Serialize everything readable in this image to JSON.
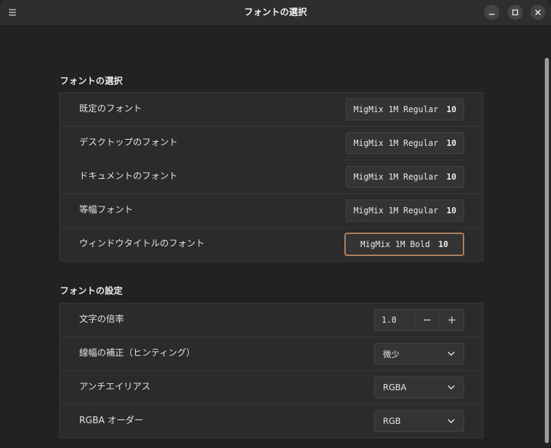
{
  "window": {
    "title": "フォントの選択"
  },
  "sections": {
    "fonts": {
      "title": "フォントの選択",
      "rows": [
        {
          "label": "既定のフォント",
          "font": "MigMix 1M Regular",
          "size": "10"
        },
        {
          "label": "デスクトップのフォント",
          "font": "MigMix 1M Regular",
          "size": "10"
        },
        {
          "label": "ドキュメントのフォント",
          "font": "MigMix 1M Regular",
          "size": "10"
        },
        {
          "label": "等幅フォント",
          "font": "MigMix 1M Regular",
          "size": "10"
        },
        {
          "label": "ウィンドウタイトルのフォント",
          "font": "MigMix 1M Bold",
          "size": "10"
        }
      ]
    },
    "settings": {
      "title": "フォントの設定",
      "scale": {
        "label": "文字の倍率",
        "value": "1.0",
        "minus": "−",
        "plus": "+"
      },
      "hinting": {
        "label": "線幅の補正（ヒンティング）",
        "value": "微少"
      },
      "antialias": {
        "label": "アンチエイリアス",
        "value": "RGBA"
      },
      "rgba_order": {
        "label": "RGBA オーダー",
        "value": "RGB"
      }
    }
  },
  "colors": {
    "focus_accent": "#b5835e"
  }
}
